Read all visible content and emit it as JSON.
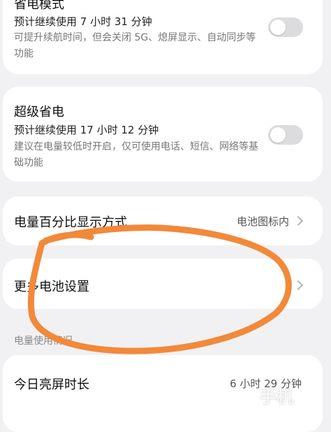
{
  "power_saving": {
    "title": "省电模式",
    "estimate": "预计继续使用 7 小时 31 分钟",
    "description": "可提升续航时间，但会关闭 5G、熄屏显示、自动同步等功能",
    "enabled": false
  },
  "super_saving": {
    "title": "超级省电",
    "estimate": "预计继续使用 17 小时 12 分钟",
    "description": "建议在电量较低时开启，仅可使用电话、短信、网络等基础功能",
    "enabled": false
  },
  "battery_percent": {
    "label": "电量百分比显示方式",
    "value": "电池图标内"
  },
  "more_settings": {
    "label": "更多电池设置"
  },
  "usage_section": {
    "header": "电量使用情况"
  },
  "screen_time": {
    "label": "今日亮屏时长",
    "value": "6 小时 29 分钟"
  },
  "annotation": {
    "color": "#f2893a"
  },
  "watermark": {
    "text": "手机"
  }
}
